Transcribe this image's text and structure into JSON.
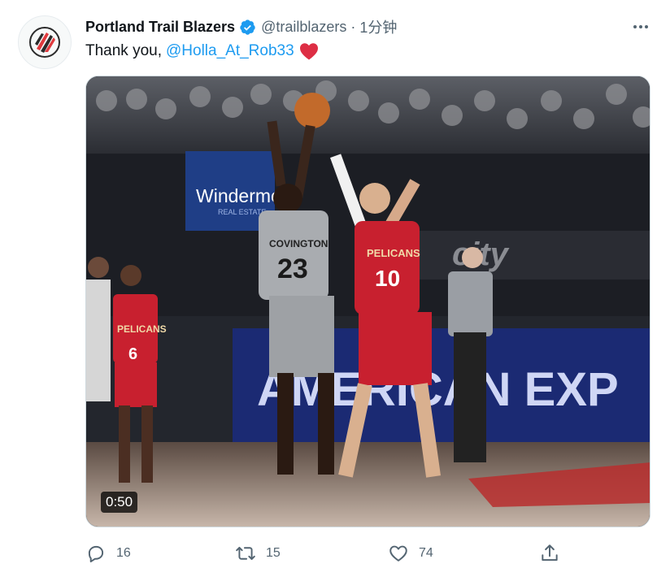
{
  "tweet": {
    "author": {
      "display_name": "Portland Trail Blazers",
      "handle": "@trailblazers",
      "verified": true,
      "avatar_icon": "trail-blazers-logo-icon"
    },
    "separator": "·",
    "time": "1分钟",
    "text_prefix": "Thank you,",
    "mention": "@Holla_At_Rob33",
    "emoji": "red-heart",
    "media": {
      "duration": "0:50",
      "jersey_left": "COVINGTON",
      "jersey_left_number": "23",
      "jersey_right_team": "PELICANS",
      "jersey_right_number": "10",
      "jersey_bg_team": "PELICANS",
      "jersey_bg_number": "6",
      "ad_board": "Windermere",
      "ad_board_sub": "REAL ESTATE",
      "baseline_ad": "AMERICAN EXP",
      "court_ad": "city"
    },
    "actions": {
      "reply_count": "16",
      "retweet_count": "15",
      "like_count": "74"
    }
  },
  "colors": {
    "accent": "#1d9bf0",
    "text": "#0f1419",
    "secondary": "#536471",
    "heart": "#e0245e",
    "blazers_red": "#e03a3e"
  }
}
